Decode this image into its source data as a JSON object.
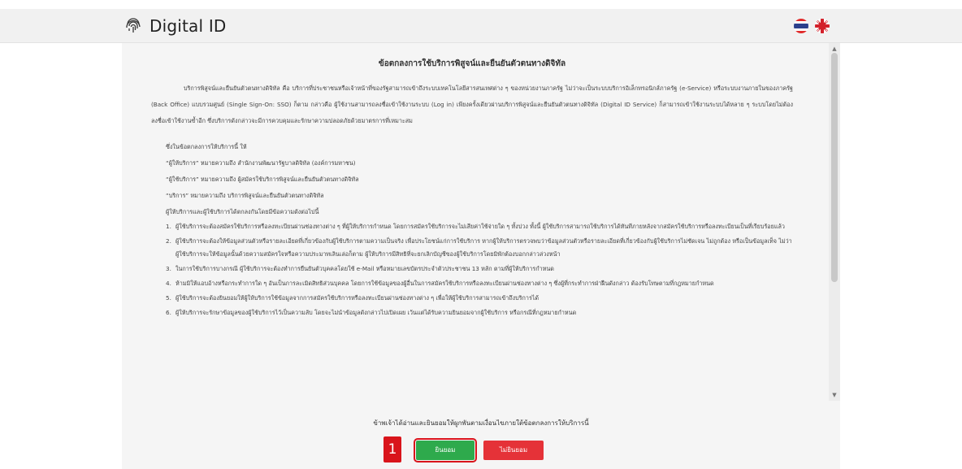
{
  "header": {
    "brand": "Digital ID",
    "brand_icon": "fingerprint-icon",
    "languages": [
      "th-flag-icon",
      "uk-flag-icon"
    ]
  },
  "document": {
    "title": "ข้อตกลงการใช้บริการพิสูจน์และยืนยันตัวตนทางดิจิทัล",
    "intro": "บริการพิสูจน์และยืนยันตัวตนทางดิจิทัล คือ บริการที่ประชาชนหรือเจ้าหน้าที่ของรัฐสามารถเข้าถึงระบบเทคโนโลยีสารสนเทศต่าง ๆ ของหน่วยงานภาครัฐ ไม่ว่าจะเป็นระบบบริการอิเล็กทรอนิกส์ภาครัฐ (e-Service) หรือระบบงานภายในของภาครัฐ (Back Office) แบบรวมศูนย์ (Single Sign-On: SSO) ก็ตาม กล่าวคือ ผู้ใช้งานสามารถลงชื่อเข้าใช้งานระบบ (Log in) เพียงครั้งเดียวผ่านบริการพิสูจน์และยืนยันตัวตนทางดิจิทัล (Digital ID Service) ก็สามารถเข้าใช้งานระบบได้หลาย ๆ ระบบโดยไม่ต้องลงชื่อเข้าใช้งานซ้ำอีก ซึ่งบริการดังกล่าวจะมีการควบคุมและรักษาความปลอดภัยด้วยมาตรการที่เหมาะสม",
    "definitions": [
      "ซึ่งในข้อตกลงการให้บริการนี้ ให้",
      "“ผู้ให้บริการ” หมายความถึง สำนักงานพัฒนารัฐบาลดิจิทัล (องค์การมหาชน)",
      "“ผู้ใช้บริการ” หมายความถึง ผู้สมัครใช้บริการพิสูจน์และยืนยันตัวตนทางดิจิทัล",
      "“บริการ” หมายความถึง บริการพิสูจน์และยืนยันตัวตนทางดิจิทัล",
      "ผู้ให้บริการและผู้ใช้บริการได้ตกลงกันโดยมีข้อความดังต่อไปนี้"
    ],
    "terms": [
      {
        "num": "1.",
        "text": "ผู้ใช้บริการจะต้องสมัครใช้บริการหรือลงทะเบียนผ่านช่องทางต่าง ๆ ที่ผู้ให้บริการกำหนด โดยการสมัครใช้บริการจะไม่เสียค่าใช้จ่ายใด ๆ ทั้งปวง ทั้งนี้ ผู้ใช้บริการสามารถใช้บริการได้ทันทีภายหลังจากสมัครใช้บริการหรือลงทะเบียนเป็นที่เรียบร้อยแล้ว"
      },
      {
        "num": "2.",
        "text": "ผู้ใช้บริการจะต้องให้ข้อมูลส่วนตัวหรือรายละเอียดที่เกี่ยวข้องกับผู้ใช้บริการตามความเป็นจริง เพื่อประโยชน์แก่การใช้บริการ หากผู้ให้บริการตรวจพบว่าข้อมูลส่วนตัวหรือรายละเอียดที่เกี่ยวข้องกับผู้ใช้บริการไม่ชัดเจน ไม่ถูกต้อง หรือเป็นข้อมูลเท็จ ไม่ว่าผู้ใช้บริการจะให้ข้อมูลนั้นด้วยความสมัครใจหรือความประมาทเลินเล่อก็ตาม ผู้ให้บริการมีสิทธิที่จะยกเลิกบัญชีของผู้ใช้บริการโดยมิพักต้องบอกกล่าวล่วงหน้า"
      },
      {
        "num": "3.",
        "text": "ในการใช้บริการบางกรณี ผู้ใช้บริการจะต้องทำการยืนยันตัวบุคคลโดยใช้ e-Mail หรือหมายเลขบัตรประจำตัวประชาชน 13 หลัก ตามที่ผู้ให้บริการกำหนด"
      },
      {
        "num": "4.",
        "text": "ห้ามมิให้แอบอ้างหรือกระทำการใด ๆ อันเป็นการละเมิดสิทธิส่วนบุคคล โดยการใช้ข้อมูลของผู้อื่นในการสมัครใช้บริการหรือลงทะเบียนผ่านช่องทางต่าง ๆ ซึ่งผู้ที่กระทำการฝ่าฝืนดังกล่าว ต้องรับโทษตามที่กฎหมายกำหนด"
      },
      {
        "num": "5.",
        "text": "ผู้ใช้บริการจะต้องยินยอมให้ผู้ให้บริการใช้ข้อมูลจากการสมัครใช้บริการหรือลงทะเบียนผ่านช่องทางต่าง ๆ เพื่อให้ผู้ใช้บริการสามารถเข้าถึงบริการได้"
      },
      {
        "num": "6.",
        "text": "ผู้ให้บริการจะรักษาข้อมูลของผู้ใช้บริการไว้เป็นความลับ โดยจะไม่นำข้อมูลดังกล่าวไปเปิดเผย เว้นแต่ได้รับความยินยอมจากผู้ใช้บริการ หรือกรณีที่กฎหมายกำหนด"
      }
    ]
  },
  "footer": {
    "consent_text": "ข้าพเจ้าได้อ่านและยินยอมให้ผูกพันตามเงื่อนไขภายใต้ข้อตกลงการให้บริการนี้",
    "step_label": "1",
    "accept_label": "ยินยอม",
    "decline_label": "ไม่ยินยอม"
  }
}
